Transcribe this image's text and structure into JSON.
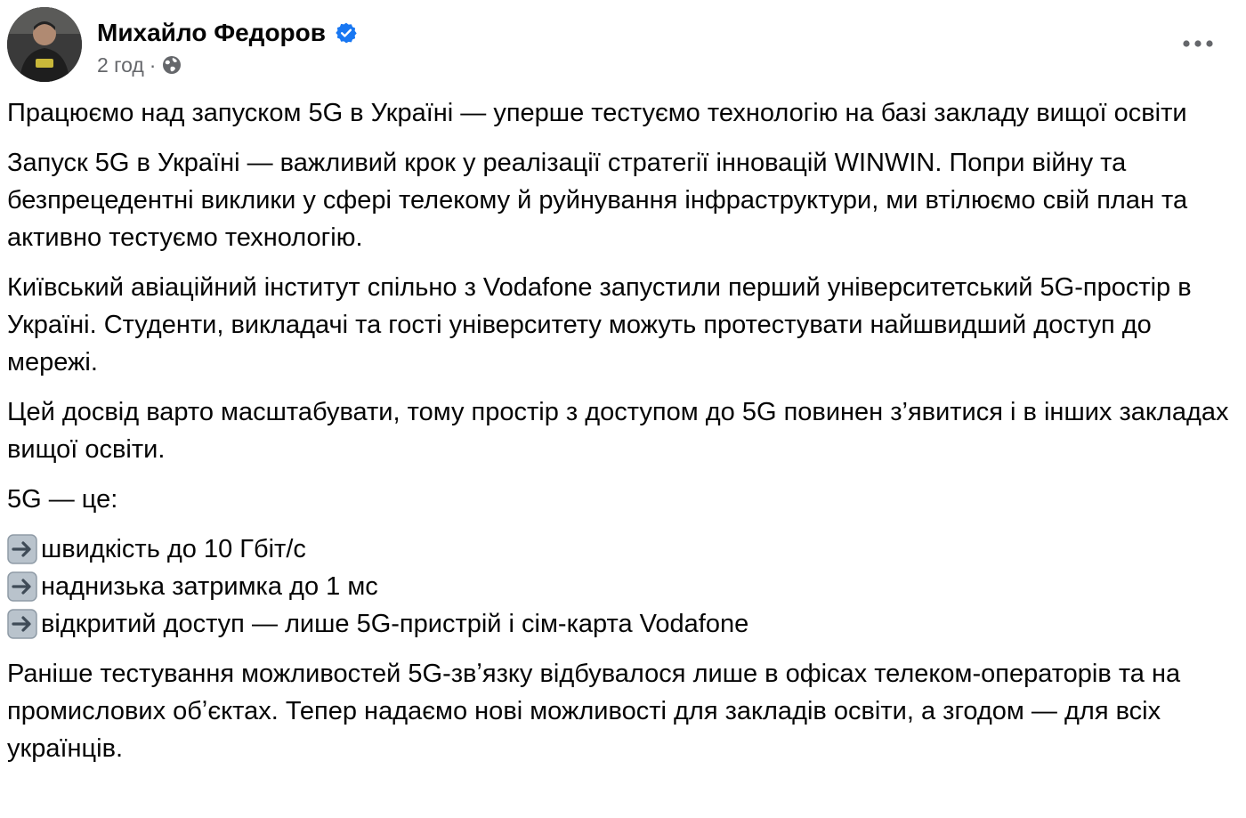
{
  "author": {
    "name": "Михайло Федоров",
    "time": "2 год",
    "separator": "·"
  },
  "icons": {
    "verified": "verified-badge-icon",
    "audience": "globe-icon",
    "more": "more-options-icon",
    "bullet": "right-arrow-icon"
  },
  "colors": {
    "verified": "#1877f2",
    "meta_text": "#65676b",
    "text": "#050505"
  },
  "post": {
    "p1": "Працюємо над запуском 5G в Україні — уперше тестуємо технологію на базі закладу вищої освіти",
    "p2": "Запуск 5G в Україні  — важливий крок у реалізації стратегії інновацій WINWIN. Попри війну та безпрецедентні виклики у сфері телекому й руйнування інфраструктури, ми втілюємо свій план та активно тестуємо технологію.",
    "p3": "Київський авіаційний інститут спільно з Vodafone запустили перший університетський 5G-простір в Україні. Студенти, викладачі та гості університету можуть протестувати найшвидший доступ до мережі.",
    "p4": "Цей досвід варто масштабувати, тому простір з доступом до 5G повинен з’явитися і в інших закладах вищої освіти.",
    "p5": "5G — це:",
    "bullets": [
      "швидкість до 10 Гбіт/с",
      "наднизька затримка до 1 мс",
      "відкритий доступ — лише 5G-пристрій і сім-карта Vodafone"
    ],
    "p6": "Раніше тестування можливостей 5G-звʼязку відбувалося лише в офісах телеком-операторів та на промислових обʼєктах. Тепер надаємо нові можливості для закладів освіти, а згодом — для всіх українців."
  }
}
